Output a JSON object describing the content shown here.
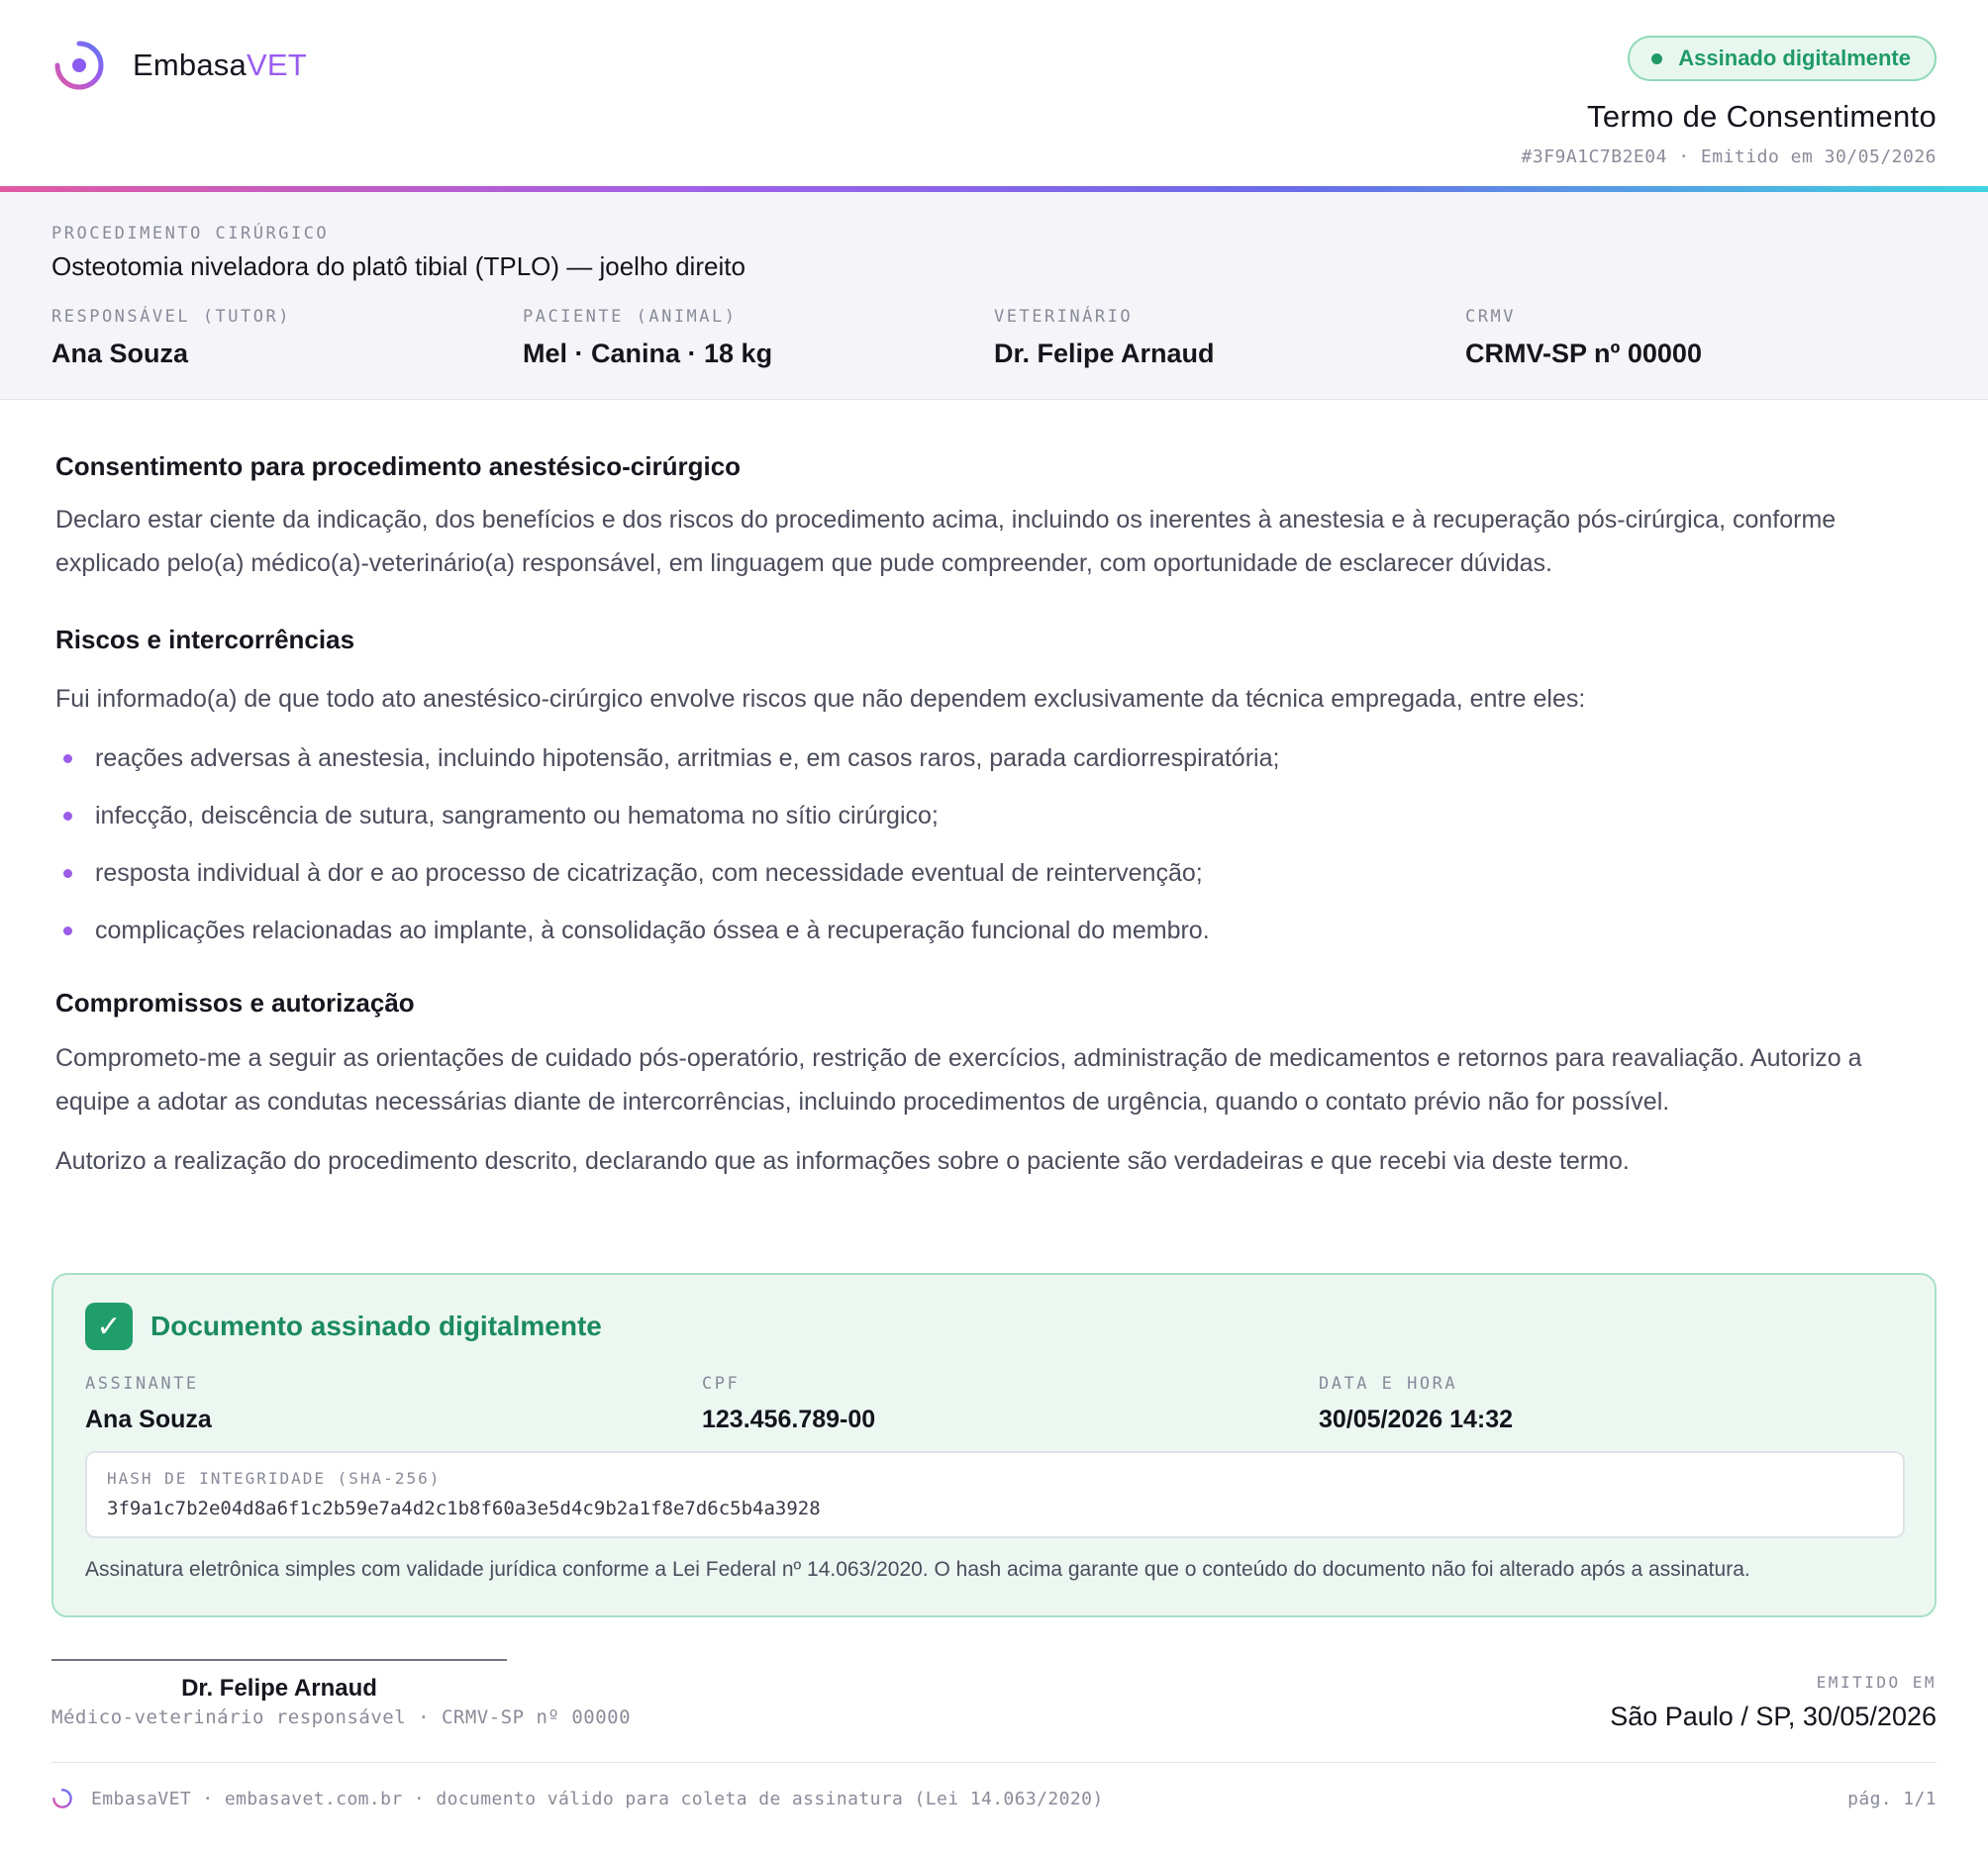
{
  "brand": {
    "name_main": "Embasa",
    "name_accent": "VET",
    "accent_color": "#9a5cf0"
  },
  "header": {
    "badge": "Assinado digitalmente",
    "title": "Termo de Consentimento",
    "meta": "#3F9A1C7B2E04 · Emitido em 30/05/2026"
  },
  "procedure": {
    "label": "PROCEDIMENTO CIRÚRGICO",
    "name": "Osteotomia niveladora do platô tibial (TPLO) — joelho direito",
    "fields": [
      {
        "label": "RESPONSÁVEL (TUTOR)",
        "value": "Ana Souza"
      },
      {
        "label": "PACIENTE (ANIMAL)",
        "value": "Mel · Canina · 18 kg"
      },
      {
        "label": "VETERINÁRIO",
        "value": "Dr. Felipe Arnaud"
      },
      {
        "label": "CRMV",
        "value": "CRMV-SP nº 00000"
      }
    ]
  },
  "sections": {
    "consent": {
      "title": "Consentimento para procedimento anestésico-cirúrgico",
      "text": "Declaro estar ciente da indicação, dos benefícios e dos riscos do procedimento acima, incluindo os inerentes à anestesia e à recuperação pós-cirúrgica, conforme explicado pelo(a) médico(a)-veterinário(a) responsável, em linguagem que pude compreender, com oportunidade de esclarecer dúvidas."
    },
    "risks": {
      "title": "Riscos e intercorrências",
      "intro": "Fui informado(a) de que todo ato anestésico-cirúrgico envolve riscos que não dependem exclusivamente da técnica empregada, entre eles:",
      "items": [
        "reações adversas à anestesia, incluindo hipotensão, arritmias e, em casos raros, parada cardiorrespiratória;",
        "infecção, deiscência de sutura, sangramento ou hematoma no sítio cirúrgico;",
        "resposta individual à dor e ao processo de cicatrização, com necessidade eventual de reintervenção;",
        "complicações relacionadas ao implante, à consolidação óssea e à recuperação funcional do membro."
      ]
    },
    "commitments": {
      "title": "Compromissos e autorização",
      "text1": "Comprometo-me a seguir as orientações de cuidado pós-operatório, restrição de exercícios, administração de medicamentos e retornos para reavaliação. Autorizo a equipe a adotar as condutas necessárias diante de intercorrências, incluindo procedimentos de urgência, quando o contato prévio não for possível.",
      "text2": "Autorizo a realização do procedimento descrito, declarando que as informações sobre o paciente são verdadeiras e que recebi via deste termo."
    }
  },
  "signature": {
    "check_symbol": "✓",
    "title": "Documento assinado digitalmente",
    "fields": [
      {
        "label": "ASSINANTE",
        "value": "Ana Souza"
      },
      {
        "label": "CPF",
        "value": "123.456.789-00"
      },
      {
        "label": "DATA E HORA",
        "value": "30/05/2026 14:32"
      }
    ],
    "hash_label": "HASH DE INTEGRIDADE (SHA-256)",
    "hash": "3f9a1c7b2e04d8a6f1c2b59e7a4d2c1b8f60a3e5d4c9b2a1f8e7d6c5b4a3928",
    "note": "Assinatura eletrônica simples com validade jurídica conforme a Lei Federal nº 14.063/2020. O hash acima garante que o conteúdo do documento não foi alterado após a assinatura."
  },
  "signer": {
    "name": "Dr. Felipe Arnaud",
    "role": "Médico-veterinário responsável · CRMV-SP nº 00000"
  },
  "issued": {
    "label": "EMITIDO EM",
    "value": "São Paulo / SP, 30/05/2026"
  },
  "footer": {
    "text": "EmbasaVET · embasavet.com.br · documento válido para coleta de assinatura (Lei 14.063/2020)",
    "page": "pág. 1/1"
  },
  "icons": {
    "brand_logo": "ring-logo-icon",
    "badge_dot": "status-dot-icon",
    "check": "check-icon",
    "bullet": "bullet-dot-icon"
  },
  "colors": {
    "success": "#1f9e6b",
    "success_bg": "#ecf7f2",
    "gradient": [
      "#e05aa2",
      "#a060e8",
      "#6a6be8",
      "#3fd3e0"
    ]
  }
}
